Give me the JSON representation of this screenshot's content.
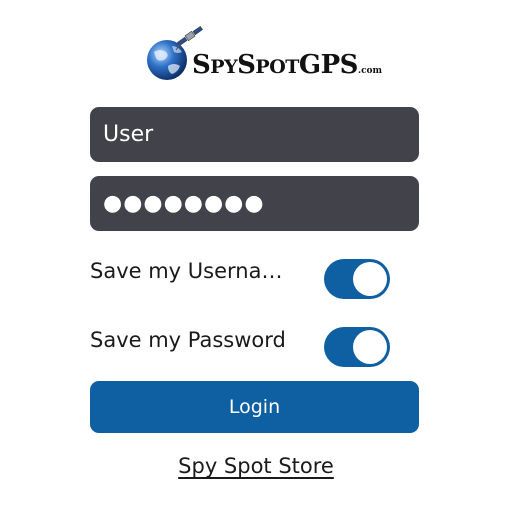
{
  "logo": {
    "brand_part1": "S",
    "brand_part2": "PY",
    "brand_part3": "S",
    "brand_part4": "POT",
    "brand_part5": "GPS",
    "brand_tld": ".com",
    "icon": "globe-satellite-icon"
  },
  "form": {
    "username_value": "User",
    "password_mask": "●●●●●●●●",
    "save_username_label": "Save my Userna…",
    "save_username_on": true,
    "save_password_label": "Save my Password",
    "save_password_on": true,
    "login_label": "Login"
  },
  "footer": {
    "store_link": "Spy Spot Store"
  },
  "colors": {
    "field_bg": "#42424a",
    "accent": "#0f5fa3",
    "text": "#1a1a1a"
  }
}
